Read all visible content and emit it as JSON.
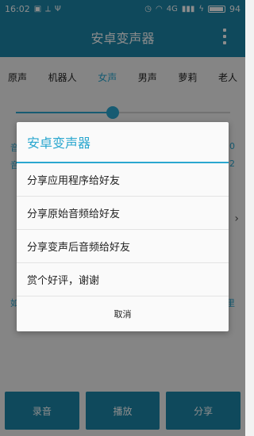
{
  "status_bar": {
    "time": "16:02",
    "battery": "94",
    "battery_level": 0.94,
    "signal_label": "4G"
  },
  "app": {
    "title": "安卓变声器"
  },
  "tabs": [
    {
      "label": "原声"
    },
    {
      "label": "机器人"
    },
    {
      "label": "女声",
      "active": true
    },
    {
      "label": "男声"
    },
    {
      "label": "萝莉"
    },
    {
      "label": "老人"
    }
  ],
  "slider": {
    "value": 0.45
  },
  "background_peek": {
    "left_1": "音",
    "left_2": "音",
    "right_1": "0",
    "right_2": "2",
    "left_3": "如",
    "right_3": "里",
    "chevron": "›"
  },
  "buttons": {
    "record": "录音",
    "play": "播放",
    "share": "分享"
  },
  "dialog": {
    "title": "安卓变声器",
    "items": [
      "分享应用程序给好友",
      "分享原始音频给好友",
      "分享变声后音频给好友",
      "赏个好评，谢谢"
    ],
    "cancel": "取消"
  },
  "colors": {
    "primary": "#1c86a8",
    "accent": "#2aa7cf"
  }
}
